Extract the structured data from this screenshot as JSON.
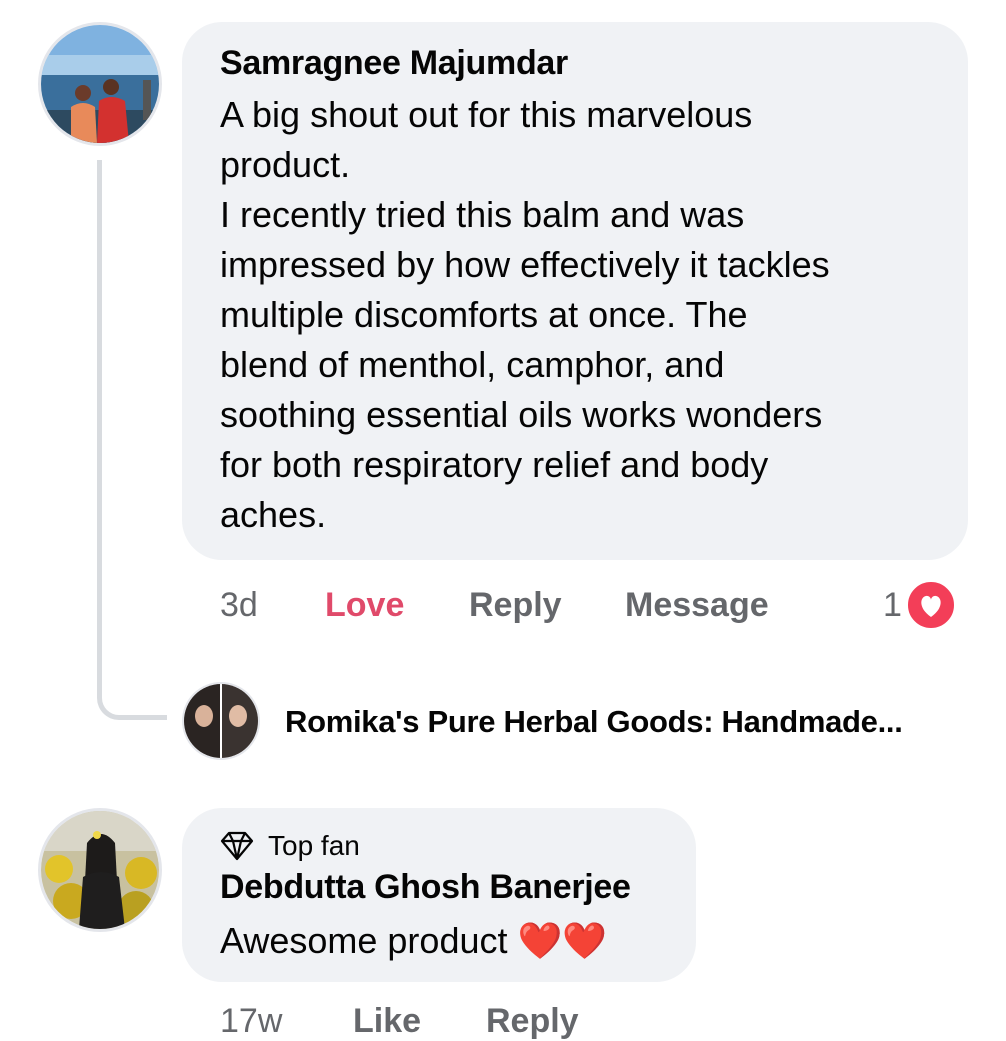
{
  "comments": [
    {
      "author": "Samragnee Majumdar",
      "lines": [
        "A big shout out for this marvelous",
        "product.",
        "I recently tried this balm and was",
        "impressed by how effectively it tackles",
        "multiple discomforts at once. The",
        "blend of menthol, camphor, and",
        "soothing essential oils works wonders",
        "for both respiratory relief and body",
        "aches."
      ],
      "time": "3d",
      "love_label": "Love",
      "reply_label": "Reply",
      "message_label": "Message",
      "reaction_count": "1",
      "reaction_icon": "heart-reaction-icon"
    },
    {
      "badge": "Top fan",
      "badge_icon": "diamond-icon",
      "author": "Debdutta Ghosh Banerjee",
      "text": "Awesome product",
      "emoji": "❤️❤️",
      "time": "17w",
      "like_label": "Like",
      "reply_label": "Reply"
    }
  ],
  "reply_preview": {
    "author": "Romika's Pure Herbal Goods: Handmade..."
  },
  "colors": {
    "bubble": "#f0f2f5",
    "love": "#e04a6a",
    "reaction": "#f33e58",
    "muted": "#65676b"
  }
}
